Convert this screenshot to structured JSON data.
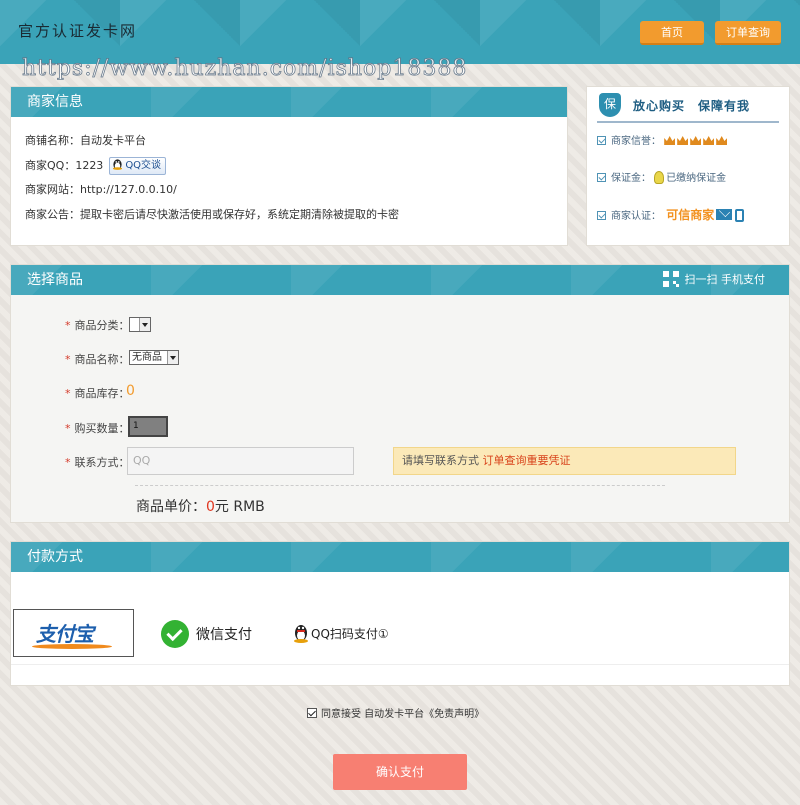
{
  "header": {
    "logo": "官方认证发卡网",
    "watermark": "https://www.huzhan.com/ishop18388",
    "nav": {
      "home": "首页",
      "order_query": "订单查询"
    }
  },
  "merchant": {
    "title": "商家信息",
    "shop_name": "商铺名称：自动发卡平台",
    "qq_label": "商家QQ：1223",
    "qq_button": "QQ交谈",
    "website": "商家网站：http://127.0.0.10/",
    "notice": "商家公告：提取卡密后请尽快激活使用或保存好，系统定期清除被提取的卡密"
  },
  "assurance": {
    "title": "放心购买　保障有我",
    "shield_text": "保",
    "credit_label": "商家信誉：",
    "credit_level": 5,
    "deposit_label": "保证金：",
    "deposit_value": "已缴纳保证金",
    "cert_label": "商家认证：",
    "cert_value": "可信商家"
  },
  "goods": {
    "title": "选择商品",
    "scan_label": "扫一扫 手机支付",
    "category_label": "商品分类：",
    "category_value": "",
    "name_label": "商品名称：",
    "name_value": "无商品",
    "stock_label": "商品库存：",
    "stock_value": "0",
    "qty_label": "购买数量：",
    "qty_value": "1",
    "contact_label": "联系方式：",
    "contact_placeholder": "QQ",
    "tip_prefix": "请填写联系方式 ",
    "tip_emphasis": "订单查询重要凭证",
    "price_label": "商品单价：",
    "price_value": "0",
    "price_unit": "元 RMB",
    "required_mark": "*"
  },
  "payment": {
    "title": "付款方式",
    "alipay": "支付宝",
    "wechat": "微信支付",
    "qq": "QQ扫码支付①"
  },
  "agree": {
    "text": "同意接受 自动发卡平台《免责声明》"
  },
  "submit": {
    "label": "确认支付"
  },
  "colors": {
    "header_bg": "#3aa3b8",
    "nav_btn": "#f29b2e",
    "submit_btn": "#f77f72",
    "required": "#d43a2a",
    "tip_bg": "#fbe9b8"
  }
}
